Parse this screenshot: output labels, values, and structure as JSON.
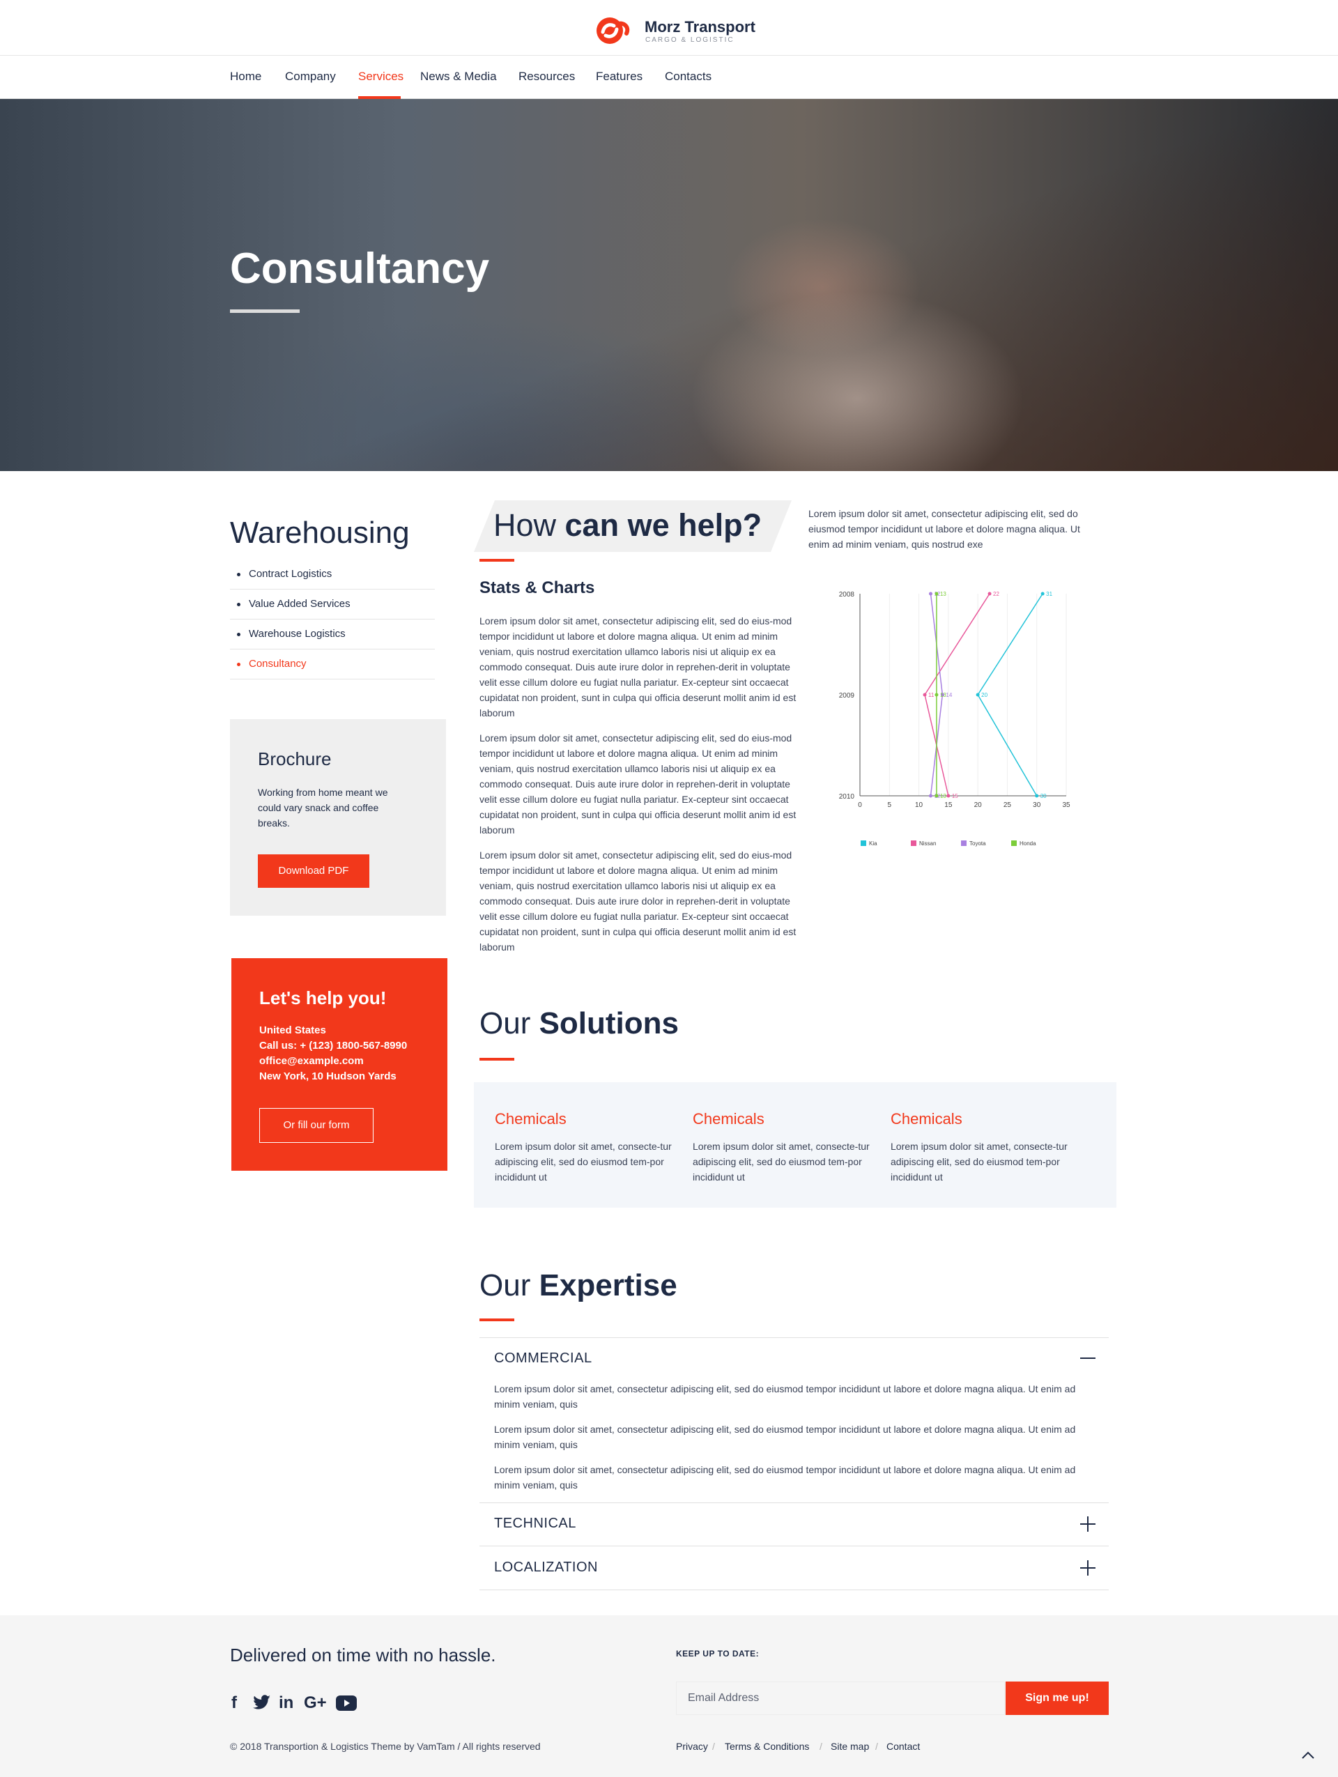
{
  "header": {
    "brand": "Morz Transport",
    "tagline": "CARGO & LOGISTIC",
    "nav": [
      "Home",
      "Company",
      "Services",
      "News & Media",
      "Resources",
      "Features",
      "Contacts"
    ],
    "active_nav": "Services"
  },
  "hero": {
    "title": "Consultancy"
  },
  "sidebar": {
    "title": "Warehousing",
    "items": [
      "Contract Logistics",
      "Value Added Services",
      "Warehouse Logistics",
      "Consultancy"
    ],
    "active_item": "Consultancy",
    "brochure": {
      "title": "Brochure",
      "text": "Working from home meant we could vary snack and coffee breaks.",
      "button": "Download PDF"
    },
    "help": {
      "title": "Let's help you!",
      "country": "United States",
      "phone": "Call us: + (123) 1800-567-8990",
      "email": "office@example.com",
      "address": "New York, 10 Hudson Yards",
      "button": "Or fill our form"
    }
  },
  "main": {
    "help_heading_light": "How ",
    "help_heading_bold": "can we help?",
    "help_intro": "Lorem ipsum dolor sit amet, consectetur adipiscing elit, sed do eiusmod tempor incididunt ut labore et dolore magna aliqua. Ut enim ad minim veniam, quis nostrud exe",
    "stats_title": "Stats & Charts",
    "paragraphs": [
      "Lorem ipsum dolor sit amet, consectetur adipiscing elit, sed do eius-mod tempor incididunt ut labore et dolore magna aliqua. Ut enim ad minim veniam, quis nostrud exercitation ullamco laboris nisi ut aliquip ex ea commodo consequat. Duis aute irure dolor in reprehen-derit in voluptate velit esse cillum dolore eu fugiat nulla pariatur. Ex-cepteur sint occaecat cupidatat non proident, sunt in culpa qui officia deserunt mollit anim id est laborum",
      "Lorem ipsum dolor sit amet, consectetur adipiscing elit, sed do eius-mod tempor incididunt ut labore et dolore magna aliqua. Ut enim ad minim veniam, quis nostrud exercitation ullamco laboris nisi ut aliquip ex ea commodo consequat. Duis aute irure dolor in reprehen-derit in voluptate velit esse cillum dolore eu fugiat nulla pariatur. Ex-cepteur sint occaecat cupidatat non proident, sunt in culpa qui officia deserunt mollit anim id est laborum",
      "Lorem ipsum dolor sit amet, consectetur adipiscing elit, sed do eius-mod tempor incididunt ut labore et dolore magna aliqua. Ut enim ad minim veniam, quis nostrud exercitation ullamco laboris nisi ut aliquip ex ea commodo consequat. Duis aute irure dolor in reprehen-derit in voluptate velit esse cillum dolore eu fugiat nulla pariatur. Ex-cepteur sint occaecat cupidatat non proident, sunt in culpa qui officia deserunt mollit anim id est laborum"
    ],
    "solutions_heading_light": "Our ",
    "solutions_heading_bold": "Solutions",
    "solutions": [
      {
        "title": "Chemicals",
        "text": "Lorem ipsum dolor sit amet, consecte-tur adipiscing elit, sed do eiusmod tem-por incididunt ut"
      },
      {
        "title": "Chemicals",
        "text": "Lorem ipsum dolor sit amet, consecte-tur adipiscing elit, sed do eiusmod tem-por incididunt ut"
      },
      {
        "title": "Chemicals",
        "text": "Lorem ipsum dolor sit amet, consecte-tur adipiscing elit, sed do eiusmod tem-por incididunt ut"
      }
    ],
    "expertise_heading_light": "Our ",
    "expertise_heading_bold": "Expertise",
    "accordion": [
      {
        "title": "COMMERCIAL",
        "expanded": true,
        "paragraphs": [
          "Lorem ipsum dolor sit amet, consectetur adipiscing elit, sed do eiusmod tempor incididunt ut labore et dolore magna aliqua. Ut enim ad minim veniam, quis",
          "Lorem ipsum dolor sit amet, consectetur adipiscing elit, sed do eiusmod tempor incididunt ut labore et dolore magna aliqua. Ut enim ad minim veniam, quis",
          "Lorem ipsum dolor sit amet, consectetur adipiscing elit, sed do eiusmod tempor incididunt ut labore et dolore magna aliqua. Ut enim ad minim veniam, quis"
        ]
      },
      {
        "title": "TECHNICAL",
        "expanded": false
      },
      {
        "title": "LOCALIZATION",
        "expanded": false
      }
    ]
  },
  "chart_data": {
    "type": "line",
    "orientation": "horizontal-category",
    "categories": [
      "2008",
      "2009",
      "2010"
    ],
    "xticks": [
      "0",
      "5",
      "10",
      "15",
      "20",
      "25",
      "30",
      "35"
    ],
    "xlim": [
      0,
      35
    ],
    "series": [
      {
        "name": "Kia",
        "color": "#22c3d8",
        "values": [
          31,
          20,
          30
        ],
        "labels": [
          "31",
          "20",
          "30"
        ]
      },
      {
        "name": "Nissan",
        "color": "#e8589a",
        "values": [
          22,
          11,
          15
        ],
        "labels": [
          "22",
          "11",
          "15"
        ]
      },
      {
        "name": "Toyota",
        "color": "#a880e0",
        "values": [
          12,
          14,
          12
        ],
        "labels": [
          "12",
          "14",
          "12"
        ]
      },
      {
        "name": "Honda",
        "color": "#7ccd3a",
        "values": [
          13,
          13,
          13
        ],
        "labels": [
          "13",
          "13",
          "13"
        ]
      }
    ],
    "title": "",
    "xlabel": "",
    "ylabel": "",
    "grid": true,
    "legend": "bottom"
  },
  "footer": {
    "tagline": "Delivered on time with no hassle.",
    "social": [
      "facebook-icon",
      "twitter-icon",
      "linkedin-icon",
      "google-plus-icon",
      "youtube-icon"
    ],
    "copyright": "© 2018 Transportion & Logistics Theme by VamTam / All rights reserved",
    "newsletter_label": "KEEP UP TO DATE:",
    "email_placeholder": "Email Address",
    "signup_button": "Sign me up!",
    "links": [
      "Privacy",
      "Terms & Conditions",
      "Site map",
      "Contact"
    ]
  },
  "colors": {
    "accent": "#f2381b",
    "navy": "#1e2a44"
  }
}
